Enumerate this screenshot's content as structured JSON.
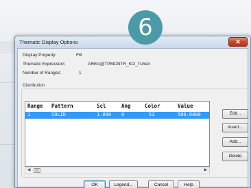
{
  "badge": {
    "number": "6"
  },
  "window": {
    "title": "Thematic Display Options",
    "close_symbol": "✕"
  },
  "properties": {
    "display_property_label": "Display Property:",
    "display_property_value": "Fill",
    "thematic_expression_label": "Thematic Expression:",
    "thematic_expression_value": "AREA@TPMCNTR_KO_Tuheli",
    "number_of_ranges_label": "Number of Ranges:",
    "number_of_ranges_value": "1"
  },
  "distribution": {
    "group_label": "Distribution",
    "columns": [
      "Range",
      "Pattern",
      "Scl",
      "Ang",
      "Color",
      "Value"
    ],
    "rows": [
      {
        "range": "1",
        "pattern": "SOLID",
        "scl": "1.000",
        "ang": "0",
        "color": "53",
        "value": "500.0000"
      }
    ],
    "scroll_left": "◀",
    "scroll_right": "▶",
    "scroll_thumb": "III"
  },
  "side_buttons": {
    "edit": {
      "label": "Edit...",
      "mnemonic": "E"
    },
    "insert": {
      "label": "Insert...",
      "mnemonic": "I"
    },
    "add": {
      "label": "Add...",
      "mnemonic": "A"
    },
    "delete": {
      "label": "Delete",
      "mnemonic": "D"
    }
  },
  "bottom_buttons": {
    "ok": {
      "label": "OK"
    },
    "legend": {
      "label": "Legend..."
    },
    "cancel": {
      "label": "Cancel"
    },
    "help": {
      "label": "Help"
    }
  },
  "colors": {
    "badge": "#4b9aa8",
    "selection": "#3399ff",
    "close_button": "#c9452c"
  },
  "icons": [
    "close-icon",
    "scroll-left-arrow-icon",
    "scroll-right-arrow-icon"
  ]
}
